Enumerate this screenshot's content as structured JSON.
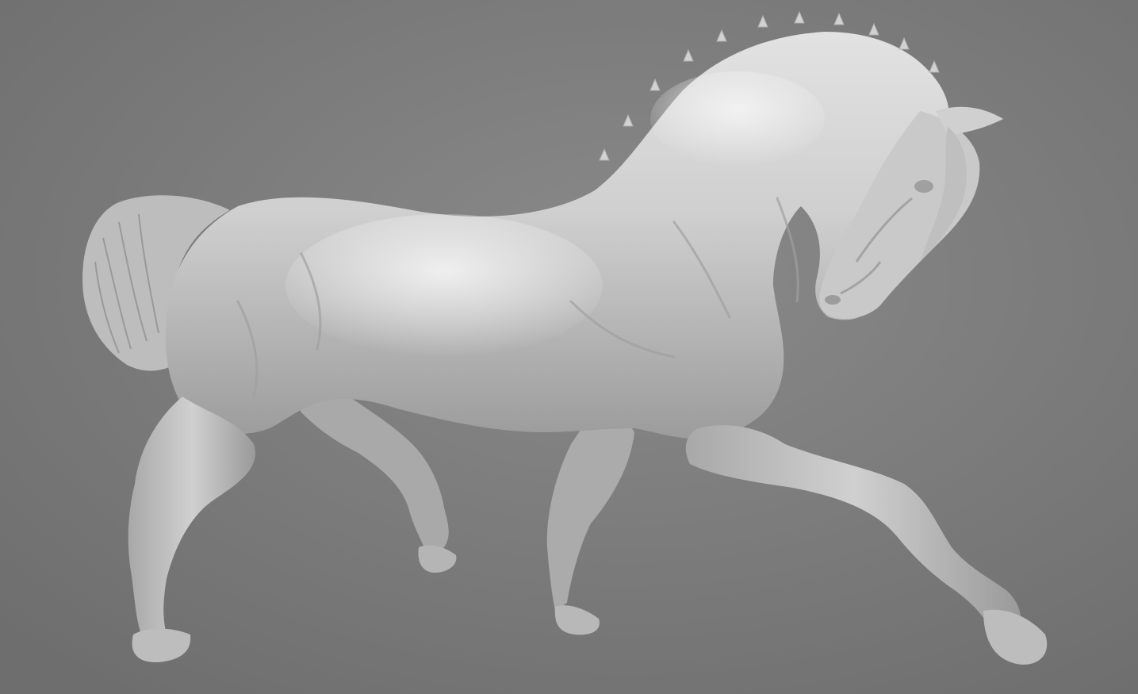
{
  "viewport": {
    "subject": "horse-sculpt-model",
    "background_color": "#7a7a7a",
    "model_color": "#c8c8c8"
  }
}
